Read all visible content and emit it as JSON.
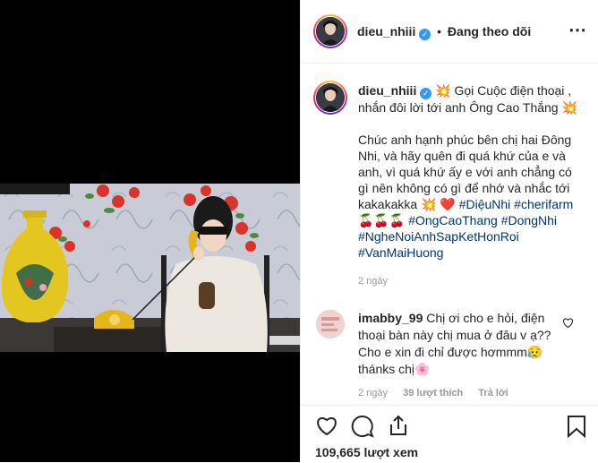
{
  "post": {
    "username": "dieu_nhiii",
    "follow_status": "Đang theo dõi",
    "separator": "•",
    "more_label": "⋯"
  },
  "caption": {
    "username": "dieu_nhiii",
    "line1": "💥 Gọi Cuộc điện thoại , nhắn đôi lời tới anh Ông Cao Thắng 💥",
    "body": "Chúc anh hạnh phúc bên chị hai Đông Nhi, và hãy quên đi quá khứ của e và anh, vì quá khứ ấy e với anh chẳng có gì nên không có gì để nhớ và nhắc tới kakakakka 💥 ❤️",
    "tags": [
      "#DiệuNhi",
      "#cherifarm",
      "🍒🍒🍒",
      "#OngCaoThang",
      "#DongNhi",
      "#NgheNoiAnhSapKetHonRoi",
      "#VanMaiHuong"
    ],
    "time": "2 ngày"
  },
  "comment": {
    "username": "imabby_99",
    "text": "Chị ơi cho e hỏi, điện thoại bàn này chị mua ở đâu v ạ?? Cho e xin đi chỉ được hơmmm😥 thánks chị🌸",
    "time": "2 ngày",
    "likes": "39 lượt thích",
    "reply": "Trả lời"
  },
  "stats": {
    "views": "109,665 lượt xem"
  },
  "icons": {
    "like": "heart-icon",
    "comment": "comment-icon",
    "share": "share-icon",
    "save": "bookmark-icon",
    "more": "more-icon",
    "comment_like": "heart-icon"
  },
  "colors": {
    "verified": "#3897f0",
    "hashtag": "#003569",
    "muted": "#999999"
  }
}
